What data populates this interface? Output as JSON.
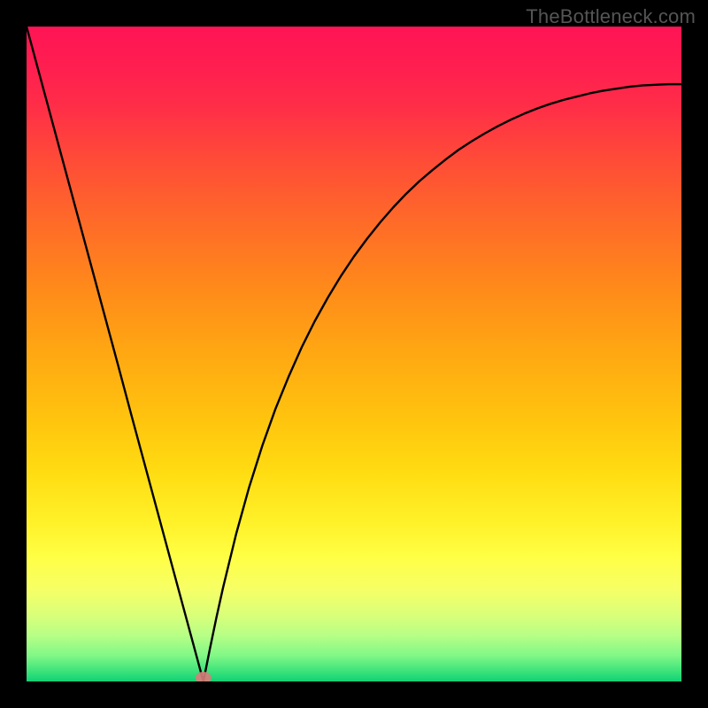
{
  "watermark": "TheBottleneck.com",
  "chart_data": {
    "type": "line",
    "title": "",
    "xlabel": "",
    "ylabel": "",
    "xlim": [
      0,
      100
    ],
    "ylim": [
      0,
      100
    ],
    "x_of_min": 27,
    "marker": {
      "x": 27,
      "y": 0
    },
    "gradient_stops": [
      {
        "offset": 0.0,
        "color": "#ff1455"
      },
      {
        "offset": 0.06,
        "color": "#ff1e50"
      },
      {
        "offset": 0.12,
        "color": "#ff2d48"
      },
      {
        "offset": 0.2,
        "color": "#ff4a38"
      },
      {
        "offset": 0.3,
        "color": "#ff6b28"
      },
      {
        "offset": 0.4,
        "color": "#ff8a1a"
      },
      {
        "offset": 0.5,
        "color": "#ffa812"
      },
      {
        "offset": 0.6,
        "color": "#ffc40e"
      },
      {
        "offset": 0.68,
        "color": "#ffdc12"
      },
      {
        "offset": 0.76,
        "color": "#fff22a"
      },
      {
        "offset": 0.81,
        "color": "#ffff45"
      },
      {
        "offset": 0.86,
        "color": "#f6ff66"
      },
      {
        "offset": 0.9,
        "color": "#d8ff7a"
      },
      {
        "offset": 0.93,
        "color": "#b6ff86"
      },
      {
        "offset": 0.96,
        "color": "#82f887"
      },
      {
        "offset": 0.985,
        "color": "#3ae27a"
      },
      {
        "offset": 1.0,
        "color": "#11d176"
      }
    ],
    "series": [
      {
        "name": "curve",
        "x": [
          0,
          2,
          4,
          6,
          8,
          10,
          12,
          14,
          16,
          18,
          20,
          22,
          24,
          25,
          26,
          27,
          28,
          29,
          30,
          32,
          34,
          36,
          38,
          40,
          42,
          44,
          46,
          48,
          50,
          52,
          54,
          56,
          58,
          60,
          62,
          64,
          66,
          68,
          70,
          72,
          74,
          76,
          78,
          80,
          82,
          84,
          86,
          88,
          90,
          92,
          94,
          96,
          98,
          100
        ],
        "y": [
          100,
          92.6,
          85.2,
          77.8,
          70.4,
          63.0,
          55.6,
          48.2,
          40.7,
          33.3,
          25.9,
          18.5,
          11.1,
          7.4,
          3.7,
          0.0,
          5.0,
          9.8,
          14.3,
          22.5,
          29.7,
          36.0,
          41.6,
          46.5,
          51.0,
          55.0,
          58.6,
          61.9,
          64.9,
          67.6,
          70.1,
          72.4,
          74.5,
          76.4,
          78.1,
          79.7,
          81.2,
          82.5,
          83.7,
          84.8,
          85.8,
          86.7,
          87.5,
          88.2,
          88.8,
          89.3,
          89.8,
          90.2,
          90.5,
          90.8,
          91.0,
          91.1,
          91.2,
          91.2
        ]
      }
    ]
  }
}
